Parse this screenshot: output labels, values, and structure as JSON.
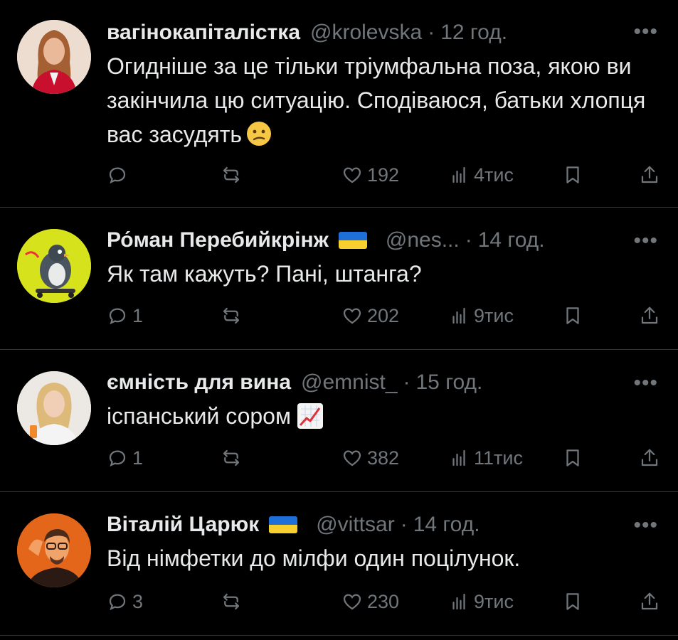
{
  "tweets": [
    {
      "name": "вагінокапіталістка",
      "handle": "@krolevska",
      "time": "12 год.",
      "text": "Огидніше за це тільки тріумфальна поза, якою ви закінчила цю ситуацію. Сподіваюся, батьки хлопця вас засудять",
      "emoji": "confused-face",
      "reply_count": "",
      "like_count": "192",
      "view_count": "4тис",
      "flag": false
    },
    {
      "name": "Ро́ман Перебийкрінж",
      "handle": "@nes...",
      "time": "14 год.",
      "text": "Як там кажуть? Пані, штанга?",
      "reply_count": "1",
      "like_count": "202",
      "view_count": "9тис",
      "flag": true
    },
    {
      "name": "ємність для вина",
      "handle": "@emnist_",
      "time": "15 год.",
      "text": "іспанський сором",
      "emoji": "chart-increasing",
      "reply_count": "1",
      "like_count": "382",
      "view_count": "11тис",
      "flag": false
    },
    {
      "name": "Віталій Царюк",
      "handle": "@vittsar",
      "time": "14 год.",
      "text": "Від німфетки до мілфи один поцілунок.",
      "reply_count": "3",
      "like_count": "230",
      "view_count": "9тис",
      "flag": true
    }
  ],
  "separator": "·",
  "more_label": "•••",
  "icons": {
    "reply": "reply-icon",
    "retweet": "retweet-icon",
    "like": "heart-icon",
    "views": "views-icon",
    "bookmark": "bookmark-icon",
    "share": "share-icon"
  },
  "colors": {
    "background": "#000000",
    "text": "#e7e9ea",
    "muted": "#71767b",
    "divider": "#2f3336"
  }
}
